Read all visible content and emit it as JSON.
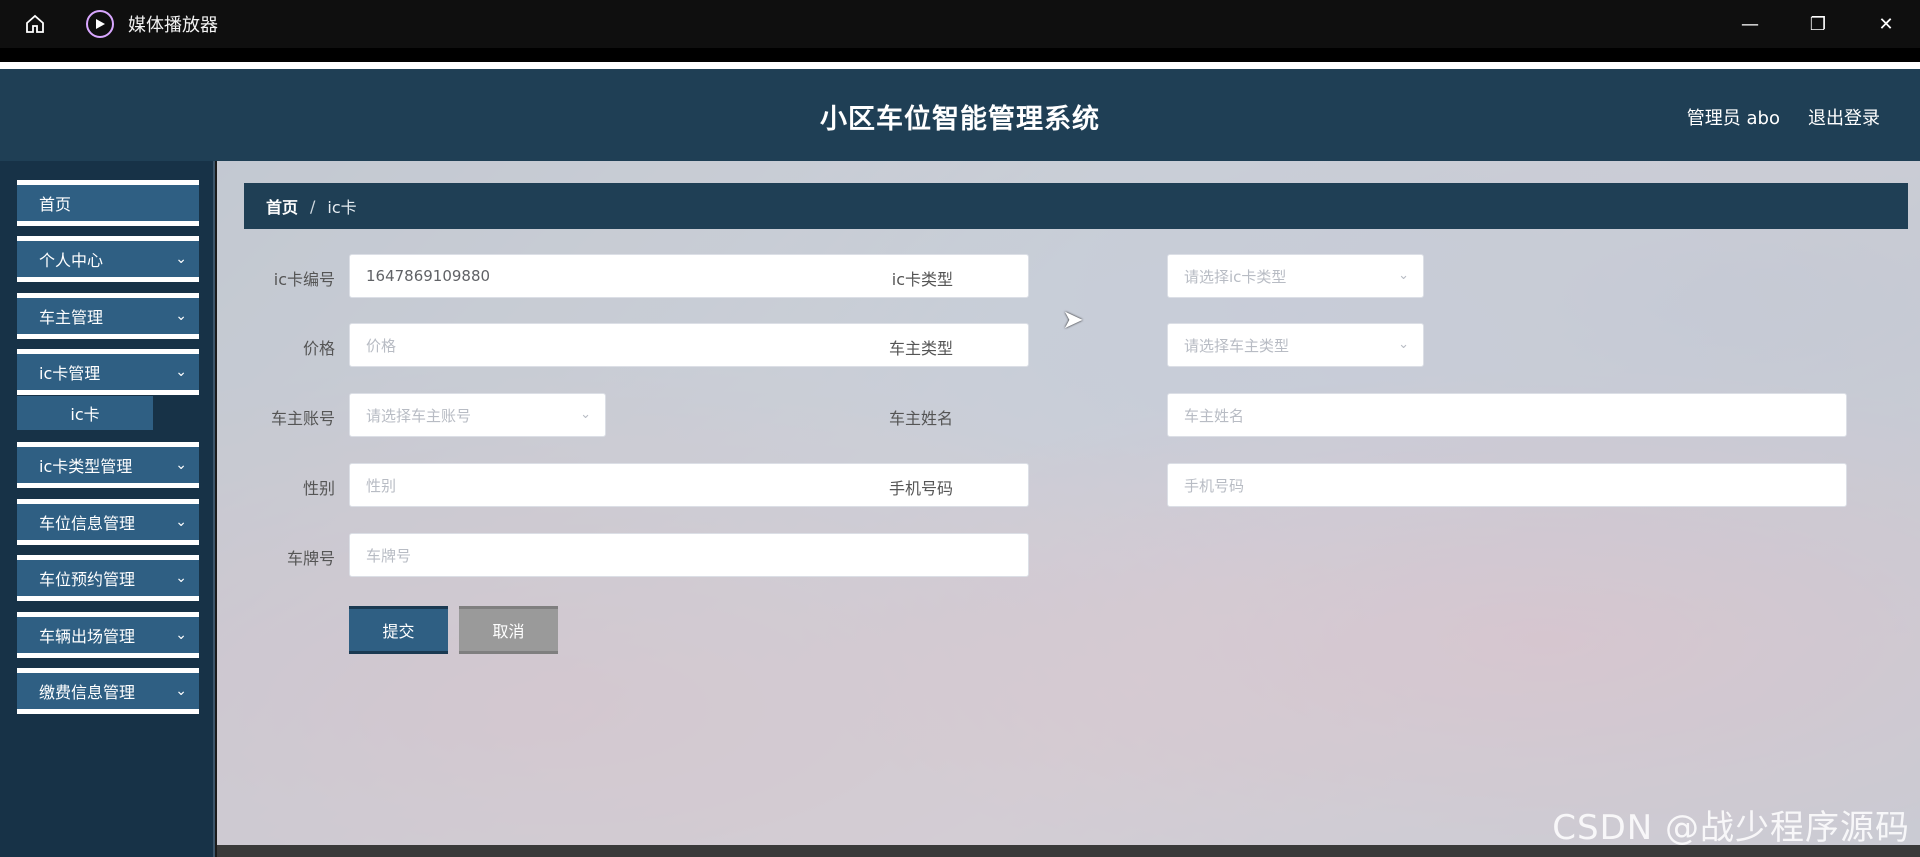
{
  "window": {
    "title": "媒体播放器",
    "controls": {
      "minimize": "—",
      "restore": "❐",
      "close": "✕"
    }
  },
  "header": {
    "site_title": "小区车位智能管理系统",
    "user_label": "管理员 abo",
    "logout_label": "退出登录"
  },
  "sidebar": {
    "items": [
      {
        "label": "首页"
      },
      {
        "label": "个人中心",
        "chevron": "⌄"
      },
      {
        "label": "车主管理",
        "chevron": "⌄"
      },
      {
        "label": "ic卡管理",
        "chevron": "⌄"
      },
      {
        "label": "ic卡类型管理",
        "chevron": "⌄"
      },
      {
        "label": "车位信息管理",
        "chevron": "⌄"
      },
      {
        "label": "车位预约管理",
        "chevron": "⌄"
      },
      {
        "label": "车辆出场管理",
        "chevron": "⌄"
      },
      {
        "label": "缴费信息管理",
        "chevron": "⌄"
      }
    ],
    "sub_item": {
      "label": "ic卡"
    }
  },
  "breadcrumb": {
    "home": "首页",
    "separator": "/",
    "current": "ic卡"
  },
  "form": {
    "card_no": {
      "label": "ic卡编号",
      "value": "1647869109880"
    },
    "card_type": {
      "label": "ic卡类型",
      "placeholder": "请选择ic卡类型"
    },
    "price": {
      "label": "价格",
      "placeholder": "价格"
    },
    "owner_type": {
      "label": "车主类型",
      "placeholder": "请选择车主类型"
    },
    "owner_account": {
      "label": "车主账号",
      "placeholder": "请选择车主账号"
    },
    "owner_name": {
      "label": "车主姓名",
      "placeholder": "车主姓名"
    },
    "gender": {
      "label": "性别",
      "placeholder": "性别"
    },
    "phone": {
      "label": "手机号码",
      "placeholder": "手机号码"
    },
    "plate": {
      "label": "车牌号",
      "placeholder": "车牌号"
    },
    "submit_label": "提交",
    "cancel_label": "取消"
  },
  "watermark": "CSDN @战少程序源码",
  "colors": {
    "header": "#1f3f55",
    "sidebar": "#173247",
    "menu": "#2f5f83",
    "cancel": "#9a9a9a"
  }
}
